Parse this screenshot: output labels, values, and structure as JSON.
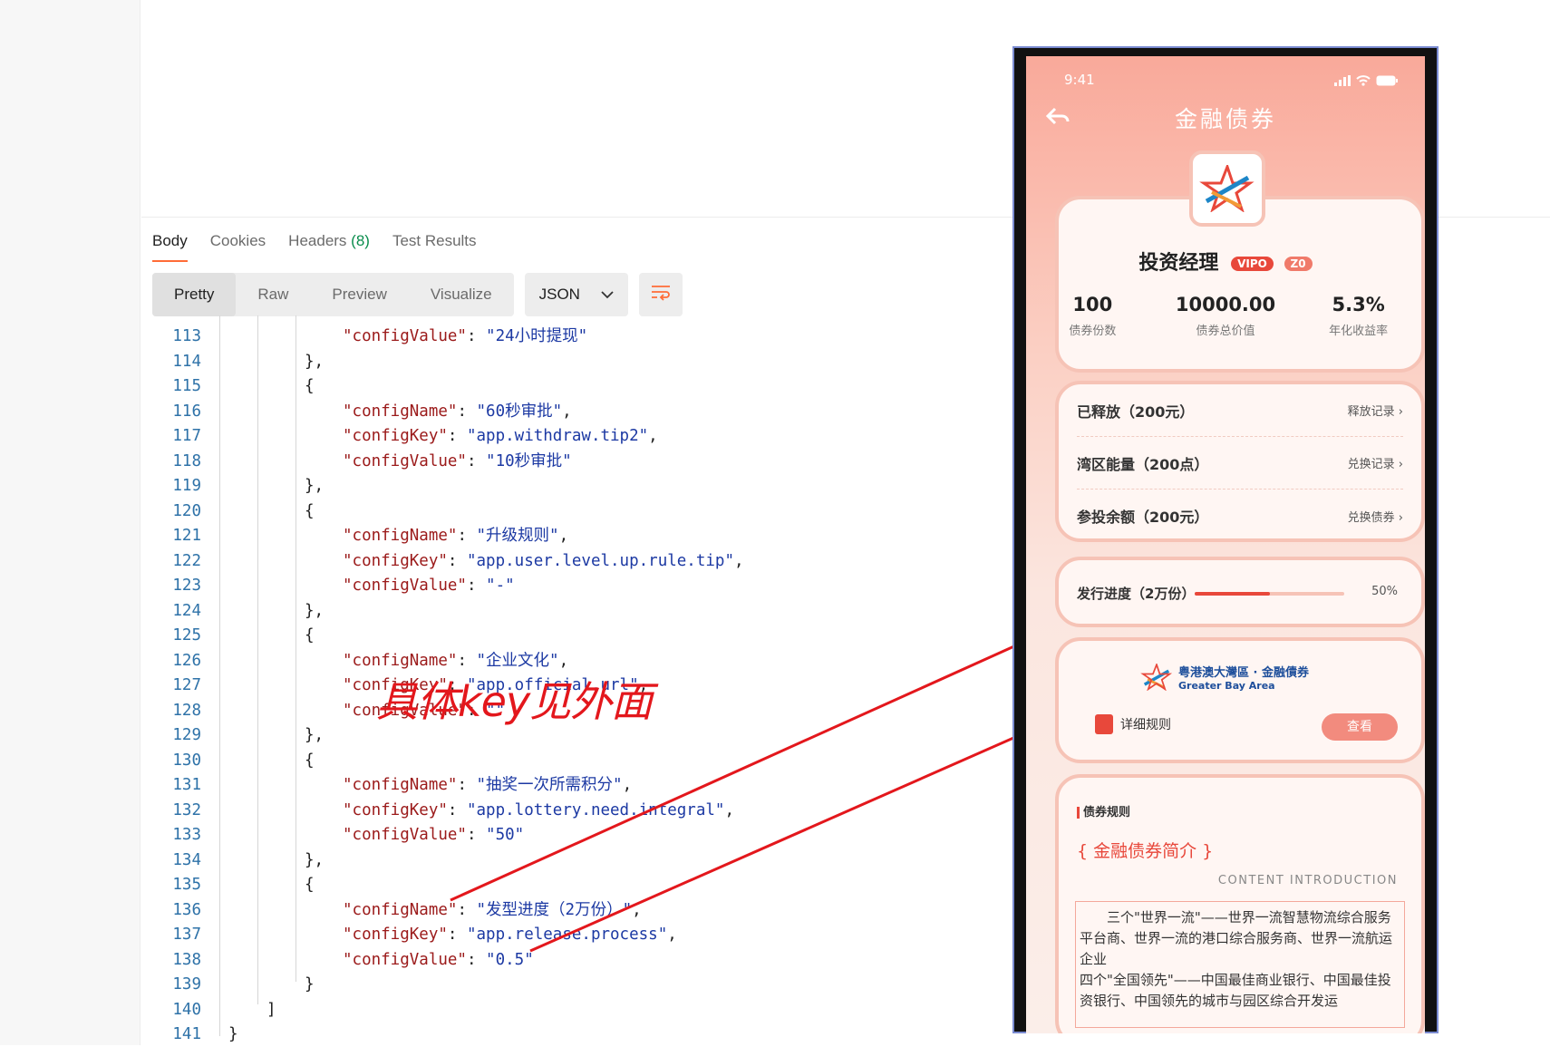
{
  "response_panel": {
    "tabs": [
      {
        "label": "Body"
      },
      {
        "label": "Cookies"
      },
      {
        "label": "Headers ",
        "count": "(8)"
      },
      {
        "label": "Test Results"
      }
    ],
    "view_modes": [
      "Pretty",
      "Raw",
      "Preview",
      "Visualize"
    ],
    "format": "JSON",
    "code_lines": [
      {
        "n": "113",
        "i": 3,
        "k": "configValue",
        "v": "24小时提现",
        "t": ""
      },
      {
        "n": "114",
        "i": 2,
        "raw": "},"
      },
      {
        "n": "115",
        "i": 2,
        "raw": "{"
      },
      {
        "n": "116",
        "i": 3,
        "k": "configName",
        "v": "60秒审批",
        "t": ","
      },
      {
        "n": "117",
        "i": 3,
        "k": "configKey",
        "v": "app.withdraw.tip2",
        "t": ","
      },
      {
        "n": "118",
        "i": 3,
        "k": "configValue",
        "v": "10秒审批",
        "t": ""
      },
      {
        "n": "119",
        "i": 2,
        "raw": "},"
      },
      {
        "n": "120",
        "i": 2,
        "raw": "{"
      },
      {
        "n": "121",
        "i": 3,
        "k": "configName",
        "v": "升级规则",
        "t": ","
      },
      {
        "n": "122",
        "i": 3,
        "k": "configKey",
        "v": "app.user.level.up.rule.tip",
        "t": ","
      },
      {
        "n": "123",
        "i": 3,
        "k": "configValue",
        "v": "-",
        "t": ""
      },
      {
        "n": "124",
        "i": 2,
        "raw": "},"
      },
      {
        "n": "125",
        "i": 2,
        "raw": "{"
      },
      {
        "n": "126",
        "i": 3,
        "k": "configName",
        "v": "企业文化",
        "t": ","
      },
      {
        "n": "127",
        "i": 3,
        "k": "configKey",
        "v": "app.official.url",
        "t": ","
      },
      {
        "n": "128",
        "i": 3,
        "k": "configValue",
        "v": "",
        "t": ""
      },
      {
        "n": "129",
        "i": 2,
        "raw": "},"
      },
      {
        "n": "130",
        "i": 2,
        "raw": "{"
      },
      {
        "n": "131",
        "i": 3,
        "k": "configName",
        "v": "抽奖一次所需积分",
        "t": ","
      },
      {
        "n": "132",
        "i": 3,
        "k": "configKey",
        "v": "app.lottery.need.integral",
        "t": ","
      },
      {
        "n": "133",
        "i": 3,
        "k": "configValue",
        "v": "50",
        "t": ""
      },
      {
        "n": "134",
        "i": 2,
        "raw": "},"
      },
      {
        "n": "135",
        "i": 2,
        "raw": "{"
      },
      {
        "n": "136",
        "i": 3,
        "k": "configName",
        "v": "发型进度（2万份）",
        "t": ","
      },
      {
        "n": "137",
        "i": 3,
        "k": "configKey",
        "v": "app.release.process",
        "t": ","
      },
      {
        "n": "138",
        "i": 3,
        "k": "configValue",
        "v": "0.5",
        "t": ""
      },
      {
        "n": "139",
        "i": 2,
        "raw": "}"
      },
      {
        "n": "140",
        "i": 1,
        "raw": "]"
      },
      {
        "n": "141",
        "i": 0,
        "raw": "}"
      }
    ]
  },
  "annotation": {
    "text": "具体key见外面",
    "color": "#e3171c"
  },
  "phone": {
    "status_time": "9:41",
    "nav_title": "金融债券",
    "profile": {
      "name": "投资经理",
      "vip_badge": "VIPO",
      "level_badge": "Z0",
      "stats": [
        {
          "value": "100",
          "label": "债券份数"
        },
        {
          "value": "10000.00",
          "label": "债券总价值"
        },
        {
          "value": "5.3%",
          "label": "年化收益率"
        }
      ]
    },
    "rows": [
      {
        "title": "已释放（200元）",
        "action": "释放记录 ›"
      },
      {
        "title": "湾区能量（200点）",
        "action": "兑换记录 ›"
      },
      {
        "title": "参投余额（200元）",
        "action": "兑换债券 ›"
      }
    ],
    "progress": {
      "label": "发行进度（2万份）",
      "value": 0.5,
      "percent_text": "50%"
    },
    "banner": {
      "brand_cn": "粤港澳大灣區 · 金融債券",
      "brand_en": "Greater Bay Area",
      "rule_label": "详细规则",
      "view_label": "查看"
    },
    "intro": {
      "section_label": "债券规则",
      "title": "{ 金融债券简介 }",
      "subtitle": "CONTENT INTRODUCTION",
      "text": "三个\"世界一流\"——世界一流智慧物流综合服务平台商、世界一流的港口综合服务商、世界一流航运企业\n四个\"全国领先\"——中国最佳商业银行、中国最佳投资银行、中国领先的城市与园区综合开发运"
    },
    "accent_color": "#e8483b"
  }
}
